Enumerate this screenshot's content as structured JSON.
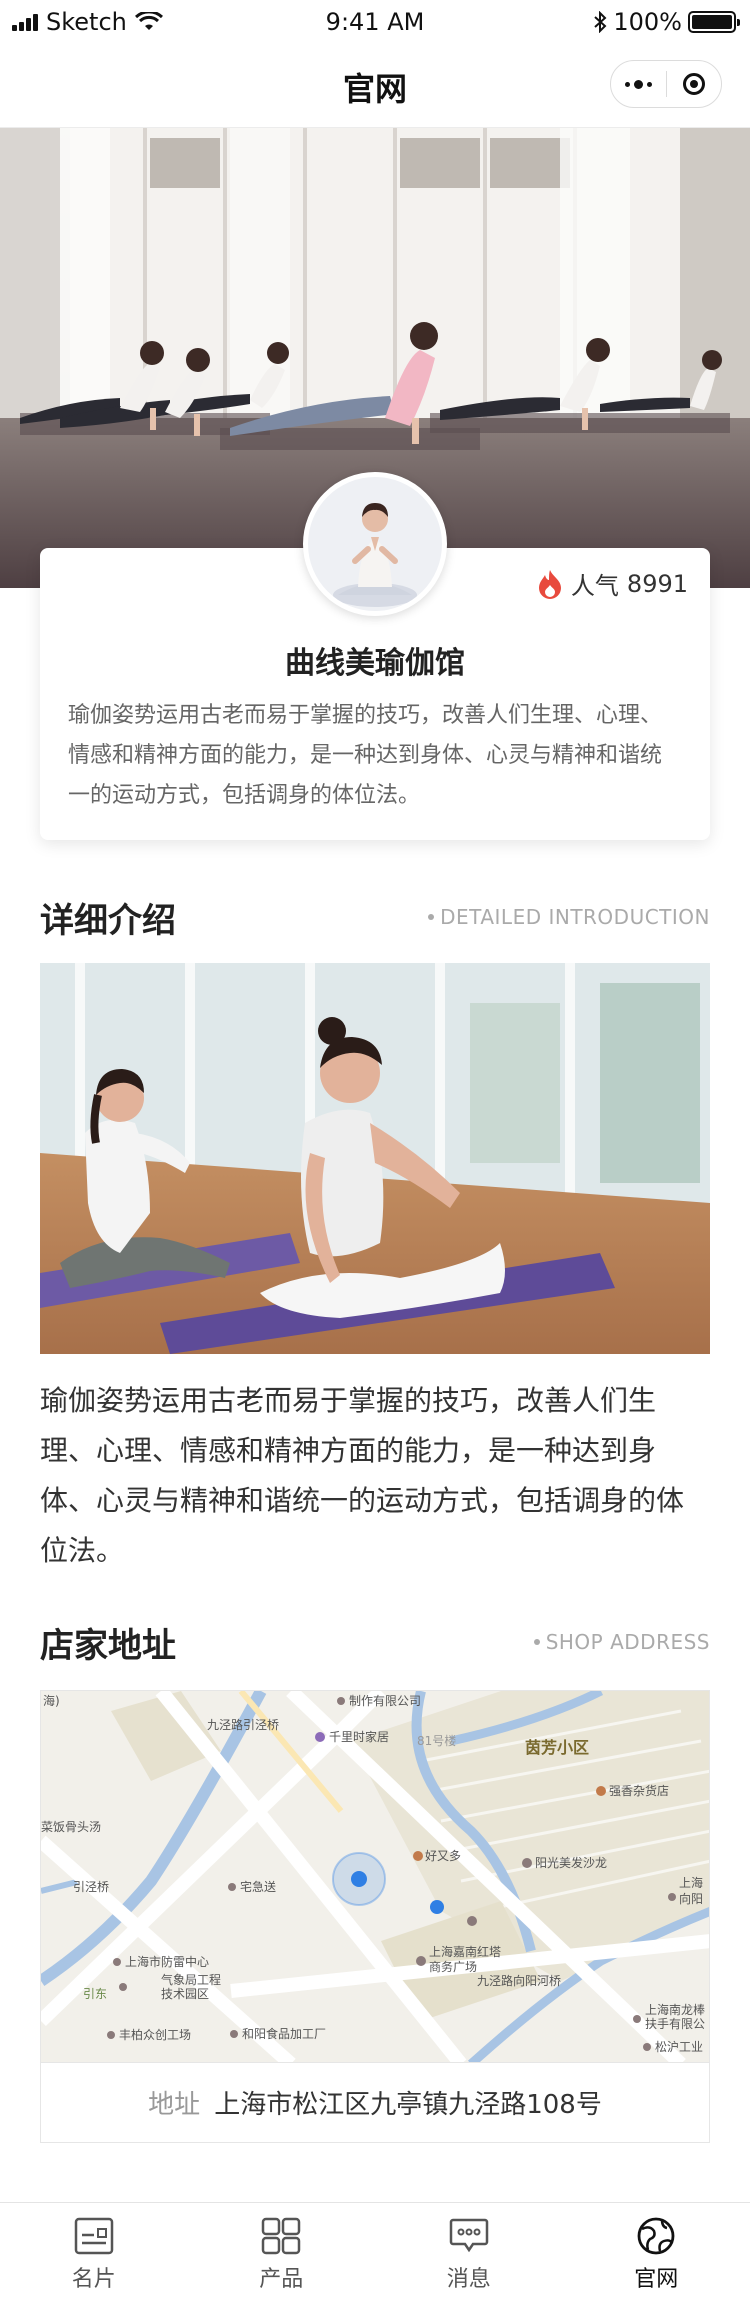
{
  "status_bar": {
    "carrier": "Sketch",
    "time": "9:41 AM",
    "battery": "100%",
    "battery_level": 1.0
  },
  "nav": {
    "title": "官网"
  },
  "profile": {
    "popularity_label": "人气",
    "popularity_count": "8991",
    "name": "曲线美瑜伽馆",
    "description": "瑜伽姿势运用古老而易于掌握的技巧，改善人们生理、心理、情感和精神方面的能力，是一种达到身体、心灵与精神和谐统一的运动方式，包括调身的体位法。"
  },
  "intro_section": {
    "title": "详细介绍",
    "subtitle": "DETAILED INTRODUCTION",
    "text": "瑜伽姿势运用古老而易于掌握的技巧，改善人们生理、心理、情感和精神方面的能力，是一种达到身体、心灵与精神和谐统一的运动方式，包括调身的体位法。"
  },
  "address_section": {
    "title": "店家地址",
    "subtitle": "SHOP ADDRESS",
    "address_label": "地址",
    "address_value": "上海市松江区九亭镇九泾路108号",
    "map_labels": {
      "l1": "海)",
      "l2": "九泾路引泾桥",
      "l3": "制作有限公司",
      "l4": "千里时家居",
      "l5": "81号楼",
      "l6": "茵芳小区",
      "l7": "强香杂货店",
      "l8": "菜饭骨头汤",
      "l9": "好又多",
      "l10": "阳光美发沙龙",
      "l11": "引泾桥",
      "l12": "宅急送",
      "l13": "上海",
      "l14": "向阳",
      "l15": "上海市防雷中心",
      "l16": "上海嘉南红塔",
      "l17": "商务广场",
      "l18": "九泾路向阳河桥",
      "l19": "气象局工程",
      "l20": "技术园区",
      "l21": "引东",
      "l22": "上海南龙棒",
      "l23": "扶手有限公",
      "l24": "丰柏众创工场",
      "l25": "和阳食品加工厂",
      "l26": "松沪工业"
    }
  },
  "tabs": [
    {
      "label": "名片",
      "icon": "card-icon"
    },
    {
      "label": "产品",
      "icon": "grid-icon"
    },
    {
      "label": "消息",
      "icon": "message-icon"
    },
    {
      "label": "官网",
      "icon": "globe-icon"
    }
  ],
  "colors": {
    "accent": "#e84a3d",
    "map_road_main": "#ffffff",
    "map_river": "#a8c4e4",
    "map_location": "#2f7fe4"
  }
}
